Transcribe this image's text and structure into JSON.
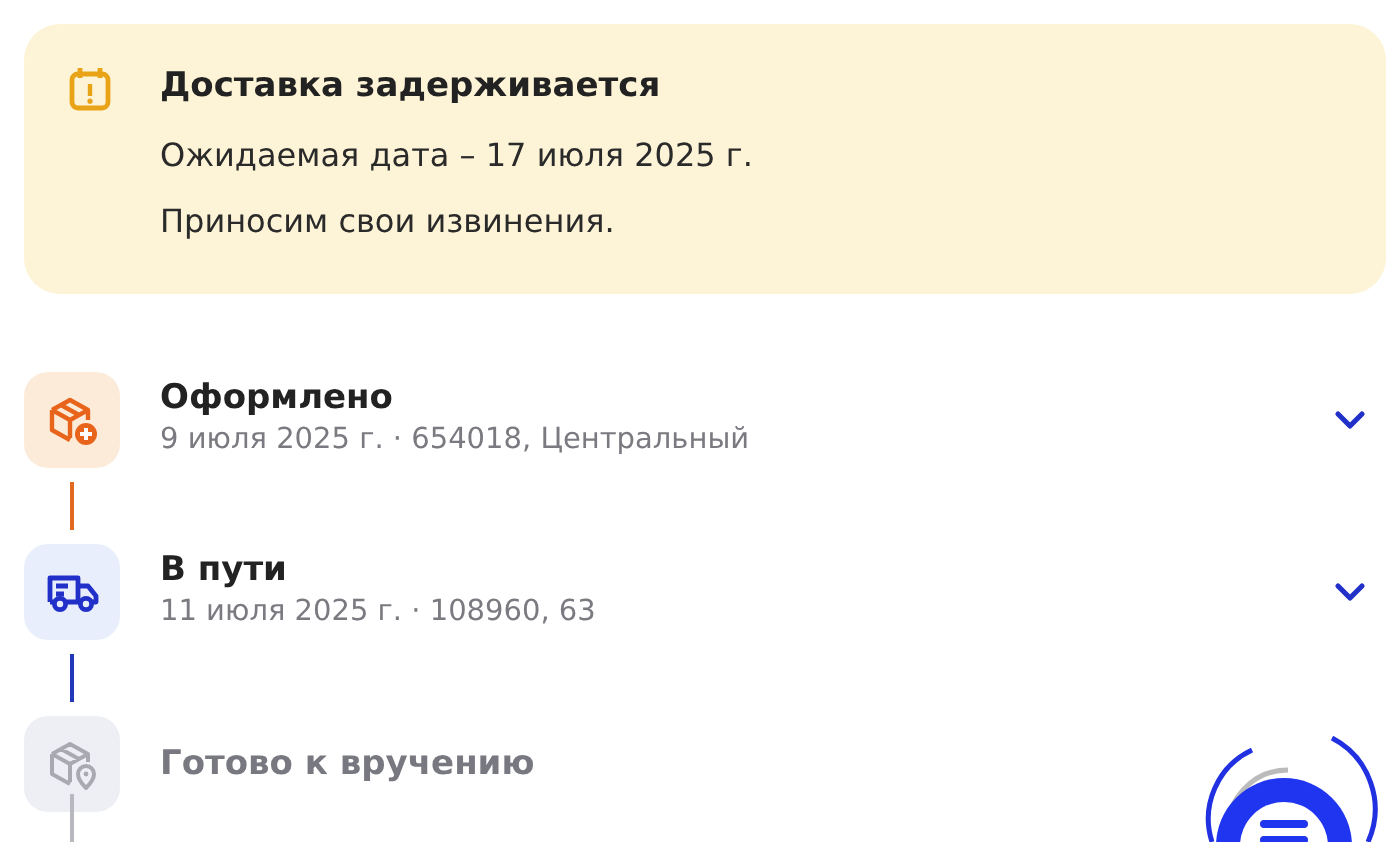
{
  "notice": {
    "title": "Доставка задерживается",
    "lines": [
      "Ожидаемая дата – 17 июля 2025 г.",
      "Приносим свои извинения."
    ]
  },
  "steps": [
    {
      "kind": "created",
      "title": "Оформлено",
      "subtitle": "9 июля 2025 г. · 654018, Центральный",
      "expandable": true
    },
    {
      "kind": "transit",
      "title": "В пути",
      "subtitle": "11 июля 2025 г. · 108960, 63",
      "expandable": true
    },
    {
      "kind": "pickup",
      "title": "Готово к вручению",
      "expandable": false
    }
  ]
}
